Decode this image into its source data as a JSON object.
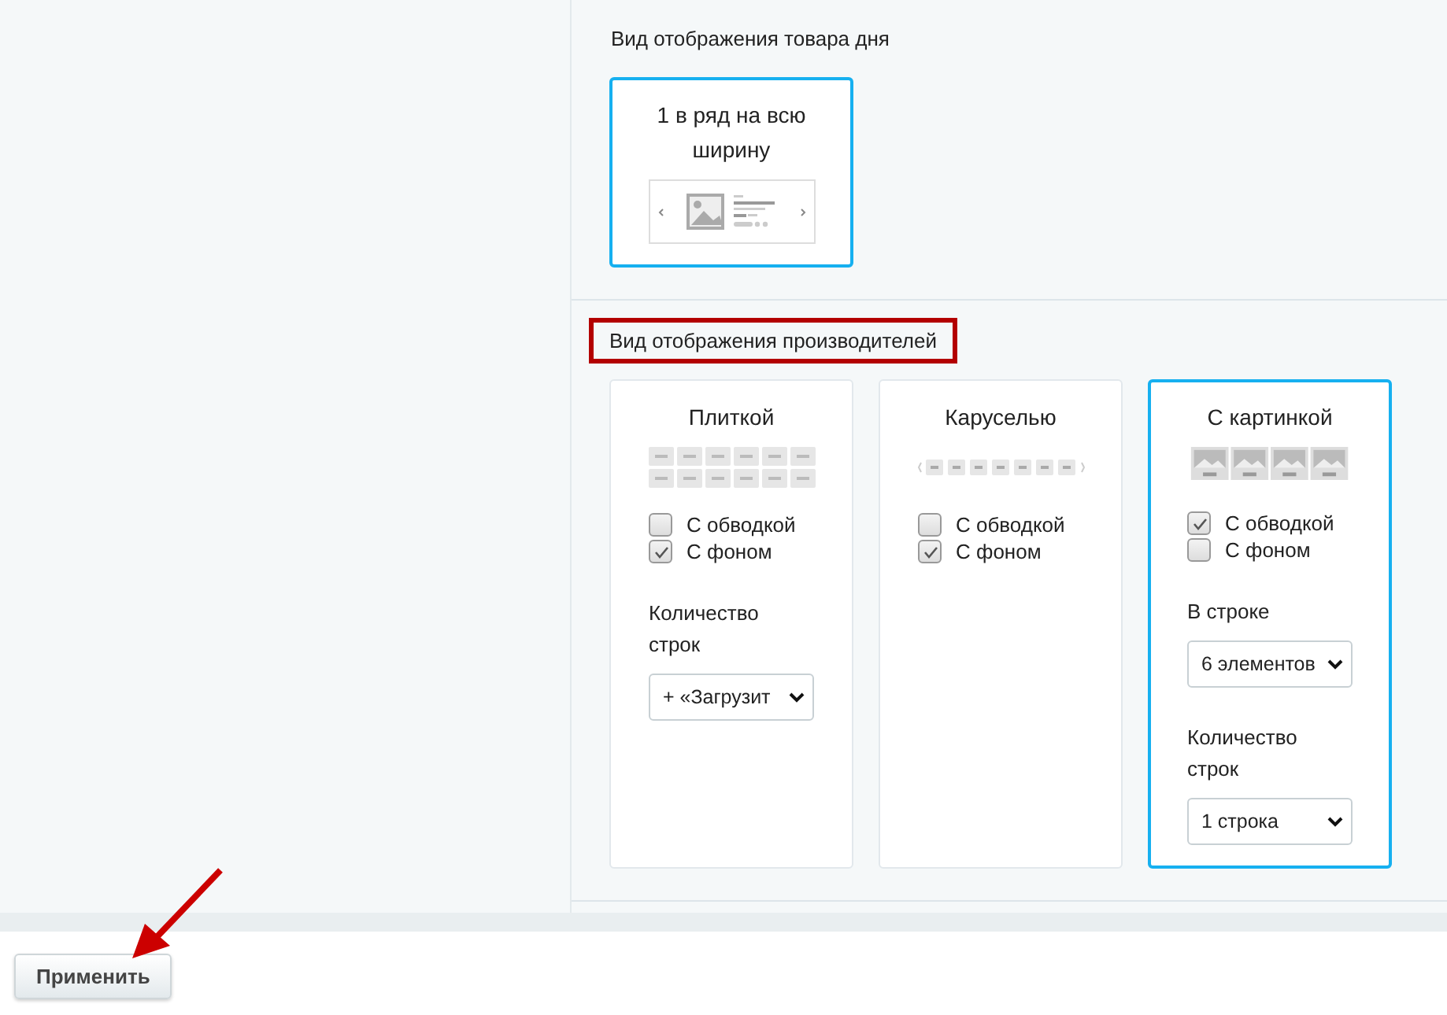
{
  "sections": [
    {
      "title": "Вид отображения товара дня",
      "highlighted": false,
      "cards": [
        {
          "label": "1 в ряд на всю ширину",
          "kind": "fullwidth",
          "selected": true
        }
      ]
    },
    {
      "title": "Вид отображения производителей",
      "highlighted": true,
      "cards": [
        {
          "label": "Плиткой",
          "kind": "tiles",
          "selected": false,
          "options": [
            {
              "label": "С обводкой",
              "checked": false
            },
            {
              "label": "С фоном",
              "checked": true
            }
          ],
          "fields": [
            {
              "label": "Количество строк",
              "value": "+ «Загрузит"
            }
          ]
        },
        {
          "label": "Каруселью",
          "kind": "carousel",
          "selected": false,
          "options": [
            {
              "label": "С обводкой",
              "checked": false
            },
            {
              "label": "С фоном",
              "checked": true
            }
          ]
        },
        {
          "label": "С картинкой",
          "kind": "pictures",
          "selected": true,
          "options": [
            {
              "label": "С обводкой",
              "checked": true
            },
            {
              "label": "С фоном",
              "checked": false
            }
          ],
          "fields": [
            {
              "label": "В строке",
              "value": "6 элементов"
            },
            {
              "label": "Количество строк",
              "value": "1 строка"
            }
          ]
        }
      ]
    }
  ],
  "apply_button": "Применить"
}
